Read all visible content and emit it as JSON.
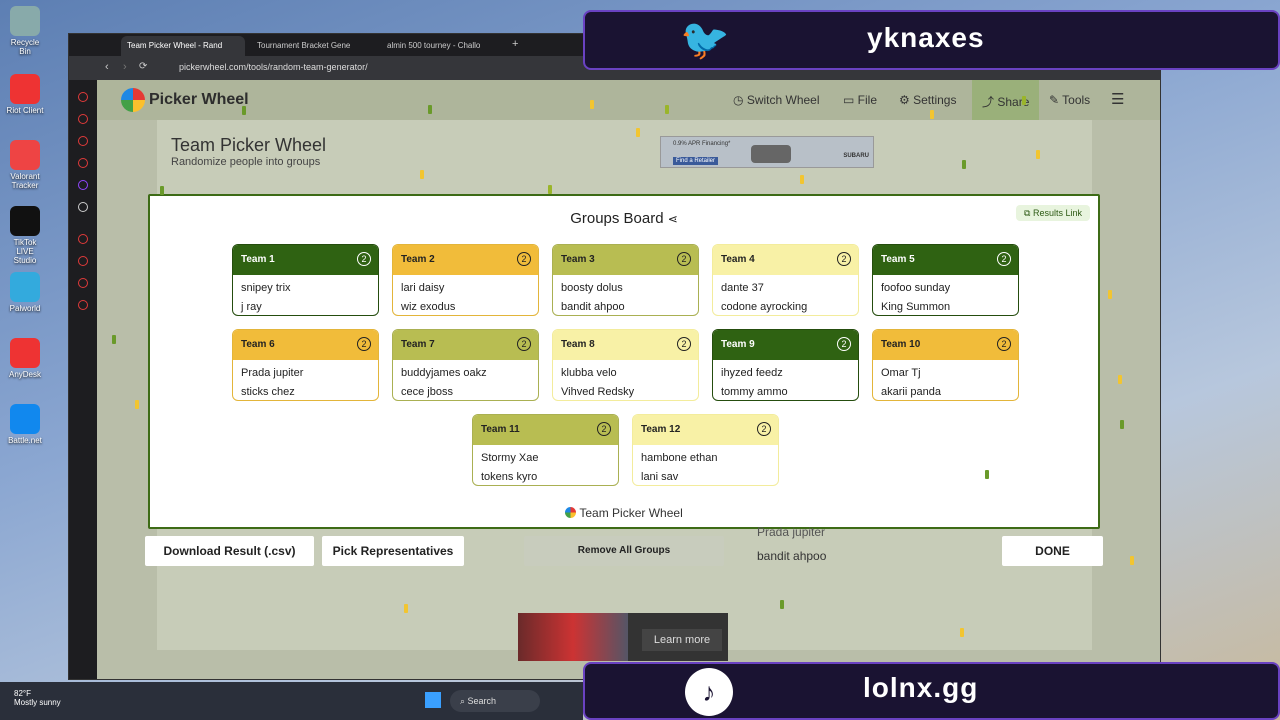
{
  "desktop": {
    "icons": [
      {
        "label": "Recycle Bin",
        "color": "#8aa"
      },
      {
        "label": "Riot Client",
        "color": "#e33"
      },
      {
        "label": "Valorant Tracker",
        "color": "#e44"
      },
      {
        "label": "TikTok LIVE Studio",
        "color": "#111"
      },
      {
        "label": "Palworld",
        "color": "#3ad"
      },
      {
        "label": "AnyDesk",
        "color": "#e33"
      },
      {
        "label": "Battle.net",
        "color": "#18e"
      }
    ]
  },
  "browser": {
    "tabs": [
      {
        "label": "Team Picker Wheel - Rand"
      },
      {
        "label": "Tournament Bracket Gene"
      },
      {
        "label": "almin 500 tourney - Challo"
      }
    ],
    "url": "pickerwheel.com/tools/random-team-generator/"
  },
  "site": {
    "logo_text": "Picker Wheel",
    "nav": {
      "switch_wheel": "Switch Wheel",
      "file": "File",
      "settings": "Settings",
      "share": "Share",
      "tools": "Tools"
    },
    "page_title": "Team Picker Wheel",
    "page_subtitle": "Randomize people into groups",
    "ad_text": "0.9% APR Financing*",
    "ad_brand": "SUBARU",
    "ad_cta": "Find a Retailer"
  },
  "modal": {
    "title": "Groups Board",
    "results_link": "Results Link",
    "footer": "Team Picker Wheel",
    "teams": [
      {
        "name": "Team 1",
        "count": "2",
        "members": [
          "snipey trix",
          "j ray"
        ],
        "style": "green"
      },
      {
        "name": "Team 2",
        "count": "2",
        "members": [
          "lari daisy",
          "wiz exodus"
        ],
        "style": "yellow"
      },
      {
        "name": "Team 3",
        "count": "2",
        "members": [
          "boosty dolus",
          "bandit ahpoo"
        ],
        "style": "olive"
      },
      {
        "name": "Team 4",
        "count": "2",
        "members": [
          "dante 37",
          "codone ayrocking"
        ],
        "style": "pale"
      },
      {
        "name": "Team 5",
        "count": "2",
        "members": [
          "foofoo sunday",
          "King Summon"
        ],
        "style": "green"
      },
      {
        "name": "Team 6",
        "count": "2",
        "members": [
          "Prada jupiter",
          "sticks chez"
        ],
        "style": "yellow"
      },
      {
        "name": "Team 7",
        "count": "2",
        "members": [
          "buddyjames oakz",
          "cece jboss"
        ],
        "style": "olive"
      },
      {
        "name": "Team 8",
        "count": "2",
        "members": [
          "klubba velo",
          "Vihved Redsky"
        ],
        "style": "pale"
      },
      {
        "name": "Team 9",
        "count": "2",
        "members": [
          "ihyzed feedz",
          "tommy ammo"
        ],
        "style": "green"
      },
      {
        "name": "Team 10",
        "count": "2",
        "members": [
          "Omar Tj",
          "akarii panda"
        ],
        "style": "yellow"
      },
      {
        "name": "Team 11",
        "count": "2",
        "members": [
          "Stormy Xae",
          "tokens kyro"
        ],
        "style": "olive"
      },
      {
        "name": "Team 12",
        "count": "2",
        "members": [
          "hambone ethan",
          "lani sav"
        ],
        "style": "pale"
      }
    ]
  },
  "buttons": {
    "download": "Download Result (.csv)",
    "pick_reps": "Pick Representatives",
    "remove_all": "Remove All Groups",
    "done": "DONE"
  },
  "background_list": [
    "Prada jupiter",
    "bandit ahpoo"
  ],
  "bottom_ad": {
    "cta": "Learn more"
  },
  "overlays": {
    "twitter_handle": "yknaxes",
    "tiktok_handle": "lolnx.gg"
  },
  "taskbar": {
    "weather_temp": "82°F",
    "weather_desc": "Mostly sunny",
    "search": "Search"
  }
}
